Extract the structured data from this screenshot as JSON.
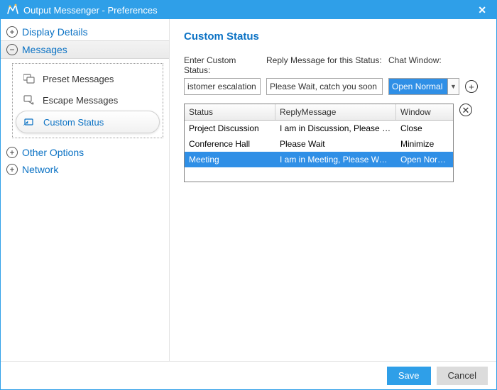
{
  "titlebar": {
    "title": "Output Messenger - Preferences"
  },
  "sidebar": {
    "categories": [
      {
        "label": "Display Details",
        "expanded": false
      },
      {
        "label": "Messages",
        "expanded": true
      },
      {
        "label": "Other Options",
        "expanded": false
      },
      {
        "label": "Network",
        "expanded": false
      }
    ],
    "messages_items": [
      {
        "label": "Preset Messages"
      },
      {
        "label": "Escape Messages"
      },
      {
        "label": "Custom Status"
      }
    ]
  },
  "content": {
    "heading": "Custom Status",
    "labels": {
      "status": "Enter Custom Status:",
      "reply": "Reply Message for this Status:",
      "chat": "Chat Window:"
    },
    "inputs": {
      "status_value": "istomer escalation",
      "reply_value": "Please Wait, catch you soon",
      "chat_selected": "Open Normal"
    },
    "table": {
      "headers": {
        "status": "Status",
        "reply": "ReplyMessage",
        "window": "Window"
      },
      "rows": [
        {
          "status": "Project Discussion",
          "reply": "I am in Discussion, Please Wai...",
          "window": "Close",
          "selected": false
        },
        {
          "status": "Conference Hall",
          "reply": "Please Wait",
          "window": "Minimize",
          "selected": false
        },
        {
          "status": "Meeting",
          "reply": "I am in Meeting, Please Wait f...",
          "window": "Open Normal",
          "selected": true
        }
      ]
    }
  },
  "footer": {
    "save": "Save",
    "cancel": "Cancel"
  }
}
